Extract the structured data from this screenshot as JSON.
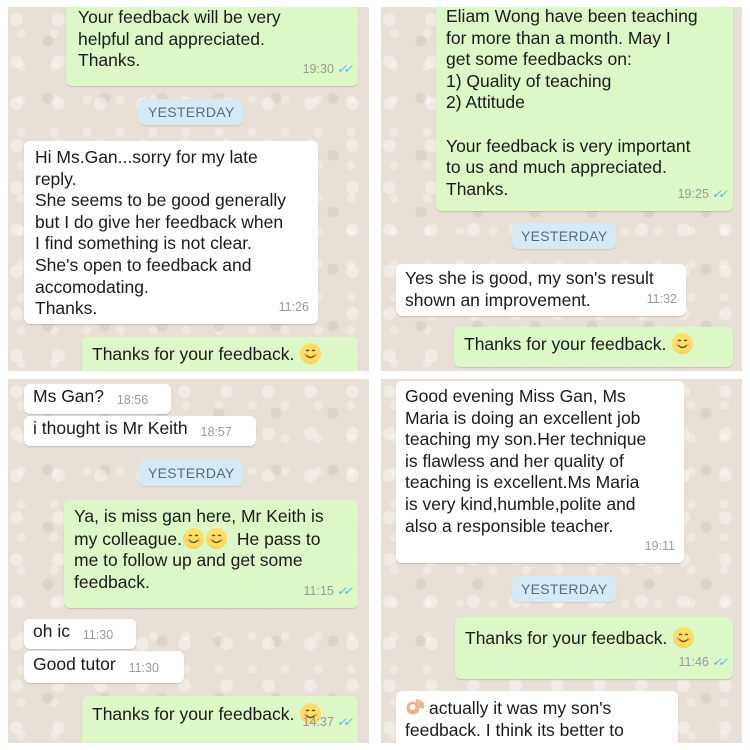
{
  "panels": {
    "top_left": {
      "msg_a": {
        "text": "Your feedback will be very\nhelpful and appreciated.\nThanks.",
        "time": "19:30"
      },
      "date_label": "YESTERDAY",
      "msg_b": {
        "text": "Hi Ms.Gan...sorry for my late\nreply.\nShe seems to be good generally\nbut I do give her feedback when\nI find something is not clear.\nShe's open to feedback and\naccomodating.\nThanks.",
        "time": "11:26"
      },
      "msg_c": {
        "text": "Thanks for your feedback."
      }
    },
    "top_right": {
      "msg_a": {
        "text": "Eliam Wong have been teaching\nfor more than a month. May I\nget some feedbacks on:\n1) Quality of teaching\n2) Attitude\n\nYour feedback is very important\nto us and much appreciated.\nThanks.",
        "time": "19:25"
      },
      "date_label": "YESTERDAY",
      "msg_b": {
        "text": "Yes she is good, my son's result\nshown an improvement.",
        "time": "11:32"
      },
      "msg_c": {
        "text": "Thanks for your feedback."
      }
    },
    "bottom_left": {
      "msg_a": {
        "text": "Ms Gan?",
        "time": "18:56"
      },
      "msg_b": {
        "text": "i thought is Mr Keith",
        "time": "18:57"
      },
      "date_label": "YESTERDAY",
      "msg_c": {
        "text_1": "Ya, is miss gan here, Mr Keith is",
        "text_2": "my colleague.",
        "text_3": "He pass to",
        "text_4": "me to follow up and get some\nfeedback.",
        "time": "11:15"
      },
      "msg_d": {
        "text": "oh ic",
        "time": "11:30"
      },
      "msg_e": {
        "text": "Good tutor",
        "time": "11:30"
      },
      "msg_f": {
        "text": "Thanks for your feedback.",
        "time": "14:37"
      }
    },
    "bottom_right": {
      "msg_a": {
        "text": "Good evening Miss Gan, Ms\nMaria is doing an excellent job\nteaching my son.Her technique\nis flawless and her quality of\nteaching is excellent.Ms Maria\nis very kind,humble,polite and\nalso a responsible teacher.",
        "time": "19:11"
      },
      "date_label": "YESTERDAY",
      "msg_b": {
        "text": "Thanks for your feedback.",
        "time": "11:46"
      },
      "msg_c": {
        "text": "actually it was my son's\nfeedback. I think its better to"
      }
    }
  },
  "icons": {
    "smile": "smiling-face-emoji",
    "ok_hand": "ok-hand-emoji",
    "read_receipt": "double-check-icon"
  },
  "colors": {
    "incoming_bubble": "#ffffff",
    "outgoing_bubble": "#dcf8c6",
    "date_pill": "#d5eaf5",
    "read_ticks": "#4fb6ec",
    "chat_background": "#e8e0d6"
  }
}
